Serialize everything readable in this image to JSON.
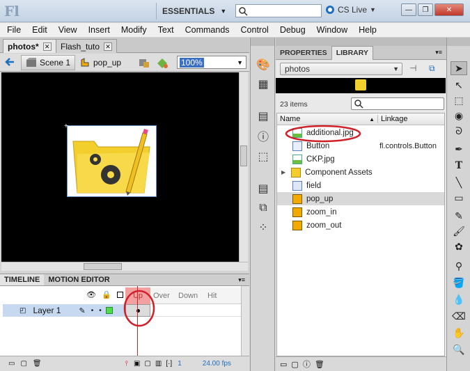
{
  "app": {
    "logo": "Fl",
    "workspace": "ESSENTIALS",
    "cs_live": "CS Live"
  },
  "window_buttons": {
    "minimize": "—",
    "restore": "❐",
    "close": "✕"
  },
  "menu": [
    "File",
    "Edit",
    "View",
    "Insert",
    "Modify",
    "Text",
    "Commands",
    "Control",
    "Debug",
    "Window",
    "Help"
  ],
  "doc_tabs": [
    {
      "label": "photos*"
    },
    {
      "label": "Flash_tuto"
    }
  ],
  "editbar": {
    "scene": "Scene 1",
    "symbol": "pop_up",
    "zoom": "100%"
  },
  "timeline": {
    "tabs": [
      "TIMELINE",
      "MOTION EDITOR"
    ],
    "frames": [
      "Up",
      "Over",
      "Down",
      "Hit"
    ],
    "layer": "Layer 1",
    "current_frame": "1",
    "fps": "24.00 fps"
  },
  "panel": {
    "tabs": [
      "PROPERTIES",
      "LIBRARY"
    ],
    "library_name": "photos",
    "item_count": "23 items",
    "columns": {
      "name": "Name",
      "linkage": "Linkage"
    },
    "items": [
      {
        "name": "additional.jpg",
        "icon": "bitmap-icon",
        "linkage": ""
      },
      {
        "name": "Button",
        "icon": "component-icon",
        "linkage": "fl.controls.Button"
      },
      {
        "name": "CKP.jpg",
        "icon": "bitmap-icon",
        "linkage": ""
      },
      {
        "name": "Component Assets",
        "icon": "folder-icon",
        "linkage": ""
      },
      {
        "name": "field",
        "icon": "graphic-icon",
        "linkage": ""
      },
      {
        "name": "pop_up",
        "icon": "button-symbol-icon",
        "linkage": ""
      },
      {
        "name": "zoom_in",
        "icon": "button-symbol-icon",
        "linkage": ""
      },
      {
        "name": "zoom_out",
        "icon": "button-symbol-icon",
        "linkage": ""
      }
    ]
  },
  "colors": {
    "highlight_circle": "#d0202a",
    "up_frame": "#f4a0a0",
    "layer_row": "#c6d9f1"
  }
}
